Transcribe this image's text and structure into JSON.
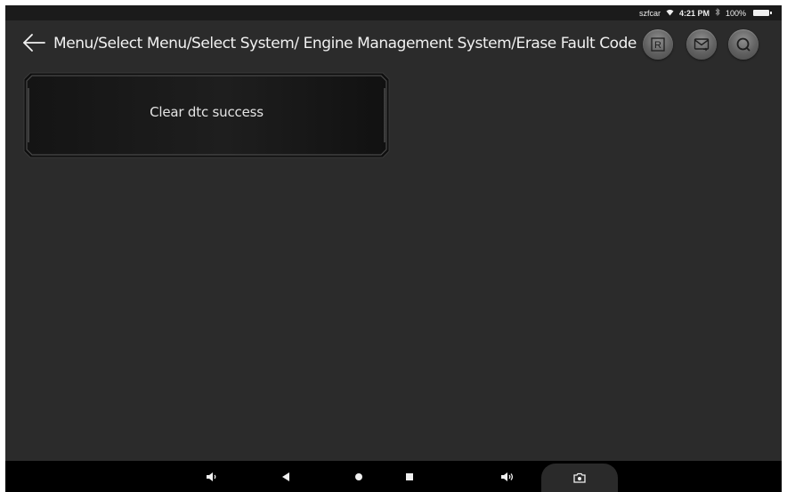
{
  "status_bar": {
    "carrier": "szfcar",
    "wifi_icon": "wifi-icon",
    "time": "4:21 PM",
    "bluetooth_icon": "bluetooth-icon",
    "battery": "100%"
  },
  "header": {
    "back_icon": "arrow-left-icon",
    "breadcrumb": "Menu/Select Menu/Select System/ Engine Management System/Erase Fault Code",
    "buttons": [
      {
        "name": "report",
        "icon": "r-icon",
        "glyph": "R"
      },
      {
        "name": "message",
        "icon": "mail-icon"
      },
      {
        "name": "search",
        "icon": "search-icon"
      }
    ]
  },
  "main": {
    "message": "Clear dtc success"
  },
  "nav_bar": {
    "buttons": [
      {
        "name": "volume-down",
        "icon": "volume-down-icon"
      },
      {
        "name": "back",
        "icon": "back-triangle-icon"
      },
      {
        "name": "home",
        "icon": "home-dot-icon"
      },
      {
        "name": "recents",
        "icon": "recents-square-icon"
      },
      {
        "name": "volume-up",
        "icon": "volume-up-icon"
      },
      {
        "name": "screenshot",
        "icon": "camera-icon"
      }
    ]
  },
  "colors": {
    "background": "#2b2b2b",
    "status_bar": "#1b1b1b",
    "nav_bar": "#000000",
    "text": "#f1f1f1",
    "header_button": "#6a6a6a"
  }
}
